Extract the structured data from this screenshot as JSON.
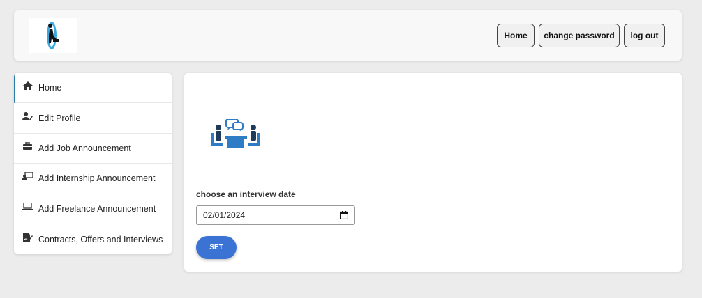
{
  "header": {
    "logo_icon": "person-portal-logo",
    "buttons": {
      "home": "Home",
      "change_password": "change password",
      "logout": "log out"
    }
  },
  "sidebar": {
    "items": [
      {
        "label": "Home",
        "icon": "home-icon",
        "active": true
      },
      {
        "label": "Edit Profile",
        "icon": "user-edit-icon"
      },
      {
        "label": "Add Job Announcement",
        "icon": "briefcase-icon"
      },
      {
        "label": "Add Internship Announcement",
        "icon": "chalkboard-teacher-icon"
      },
      {
        "label": "Add Freelance Announcement",
        "icon": "laptop-icon"
      },
      {
        "label": "Contracts, Offers and Interviews",
        "icon": "file-signature-icon"
      }
    ]
  },
  "main": {
    "illustration": "interview-meeting-icon",
    "date_label": "choose an interview date",
    "date_value": "02/01/2024",
    "set_label": "SET"
  },
  "colors": {
    "accent": "#3a73d4",
    "active_border": "#2a7fa8",
    "illustration": "#2e7bc6"
  }
}
